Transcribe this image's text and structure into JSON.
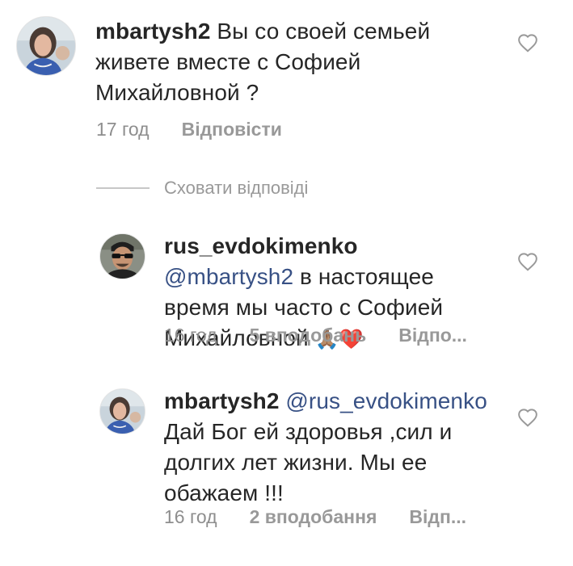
{
  "comments": [
    {
      "username": "mbartysh2",
      "mention": "",
      "text": "Вы со своей семьей живете вместе с Софией Михайловной ?",
      "time": "17 год",
      "likes": "",
      "reply": "Відповісти",
      "avatar_icon": "profile-photo-woman"
    },
    {
      "username": "rus_evdokimenko",
      "mention": "@mbartysh2",
      "text": "в настоящее время мы часто с Софией Михайловной",
      "emoji": "🙏🏽❤️",
      "time": "16 год",
      "likes": "5 вподобань",
      "reply": "Відпо...",
      "avatar_icon": "profile-photo-man-sunglasses"
    },
    {
      "username": "mbartysh2",
      "mention": "@rus_evdokimenko",
      "text": "Дай Бог ей здоровья ,сил и долгих лет жизни. Мы ее обажаем !!!",
      "time": "16 год",
      "likes": "2 вподобання",
      "reply": "Відп...",
      "avatar_icon": "profile-photo-woman"
    }
  ],
  "hide_replies": "Сховати відповіді",
  "like_icon": "heart-outline-icon",
  "colors": {
    "text": "#262626",
    "meta": "#8e8e8e",
    "mention": "#385185",
    "heart": "#999999"
  }
}
